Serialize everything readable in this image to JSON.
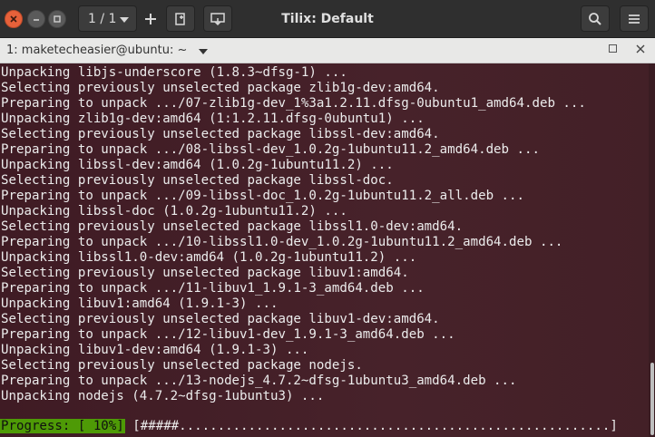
{
  "header": {
    "title": "Tilix: Default",
    "session": "1 / 1"
  },
  "terminal_bar": {
    "title": "1: maketecheasier@ubuntu: ~"
  },
  "terminal": {
    "lines": [
      "Unpacking libjs-underscore (1.8.3~dfsg-1) ...",
      "Selecting previously unselected package zlib1g-dev:amd64.",
      "Preparing to unpack .../07-zlib1g-dev_1%3a1.2.11.dfsg-0ubuntu1_amd64.deb ...",
      "Unpacking zlib1g-dev:amd64 (1:1.2.11.dfsg-0ubuntu1) ...",
      "Selecting previously unselected package libssl-dev:amd64.",
      "Preparing to unpack .../08-libssl-dev_1.0.2g-1ubuntu11.2_amd64.deb ...",
      "Unpacking libssl-dev:amd64 (1.0.2g-1ubuntu11.2) ...",
      "Selecting previously unselected package libssl-doc.",
      "Preparing to unpack .../09-libssl-doc_1.0.2g-1ubuntu11.2_all.deb ...",
      "Unpacking libssl-doc (1.0.2g-1ubuntu11.2) ...",
      "Selecting previously unselected package libssl1.0-dev:amd64.",
      "Preparing to unpack .../10-libssl1.0-dev_1.0.2g-1ubuntu11.2_amd64.deb ...",
      "Unpacking libssl1.0-dev:amd64 (1.0.2g-1ubuntu11.2) ...",
      "Selecting previously unselected package libuv1:amd64.",
      "Preparing to unpack .../11-libuv1_1.9.1-3_amd64.deb ...",
      "Unpacking libuv1:amd64 (1.9.1-3) ...",
      "Selecting previously unselected package libuv1-dev:amd64.",
      "Preparing to unpack .../12-libuv1-dev_1.9.1-3_amd64.deb ...",
      "Unpacking libuv1-dev:amd64 (1.9.1-3) ...",
      "Selecting previously unselected package nodejs.",
      "Preparing to unpack .../13-nodejs_4.7.2~dfsg-1ubuntu3_amd64.deb ...",
      "Unpacking nodejs (4.7.2~dfsg-1ubuntu3) ..."
    ],
    "progress_label": "Progress: [ 10%]",
    "progress_bar": " [#####........................................................]",
    "progress_value": 0.1
  },
  "colors": {
    "terminal_bg": "#441e28",
    "progress_label_bg": "#4e9a06",
    "close_button": "#e7613a"
  },
  "icons": {
    "close": "close-icon",
    "minimize": "minimize-icon",
    "maximize": "maximize-icon",
    "add": "plus-icon",
    "split": "split-terminal-icon",
    "save": "save-output-icon",
    "search": "search-icon",
    "menu": "hamburger-menu-icon"
  }
}
